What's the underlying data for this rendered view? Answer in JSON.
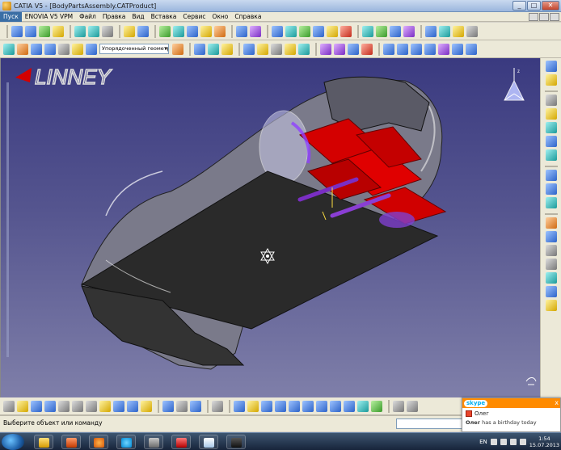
{
  "window": {
    "title": "CATIA V5 - [BodyPartsAssembly.CATProduct]",
    "minimize": "_",
    "maximize": "□",
    "close": "✕"
  },
  "menubar": {
    "items": [
      "Пуск",
      "ENOVIA V5 VPM",
      "Файл",
      "Правка",
      "Вид",
      "Вставка",
      "Сервис",
      "Окно",
      "Справка"
    ]
  },
  "toolbar": {
    "geometry_set_value": "Упорядоченный геометр"
  },
  "viewport": {
    "logo_text": "LINNEY",
    "background_top": "#3a3a80",
    "background_bottom": "#7f7fa9"
  },
  "statusbar": {
    "prompt": "Выберите объект или команду",
    "command_value": ""
  },
  "skype": {
    "brand": "skype",
    "close": "x",
    "contact": "Олег",
    "message_name": "Олег",
    "message_text": "has a birthday today"
  },
  "taskbar": {
    "language": "EN",
    "time": "1:54",
    "date": "15.07.2013"
  },
  "colors": {
    "accent": "#3a6ea5",
    "skype_orange": "#ff8b00",
    "part_red": "#d40000",
    "part_purple": "#7a2ec4"
  }
}
